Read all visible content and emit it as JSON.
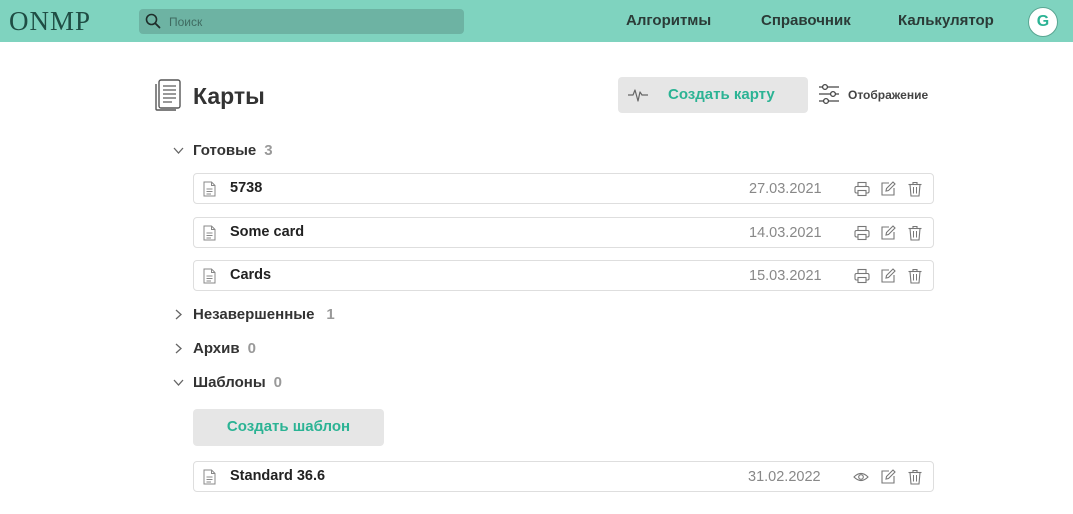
{
  "header": {
    "logo": "ONMP",
    "search": {
      "placeholder": "Поиск",
      "value": ""
    },
    "nav": [
      "Алгоритмы",
      "Справочник",
      "Калькулятор"
    ],
    "avatar_letter": "G"
  },
  "page": {
    "title": "Карты",
    "create_card_label": "Создать карту",
    "display_label": "Отображение"
  },
  "sections": {
    "ready": {
      "label": "Готовые",
      "count": "3",
      "expanded": true,
      "rows": [
        {
          "name": "5738",
          "date": "27.03.2021"
        },
        {
          "name": "Some card",
          "date": "14.03.2021"
        },
        {
          "name": "Cards",
          "date": "15.03.2021"
        }
      ]
    },
    "unfinished": {
      "label": "Незавершенные",
      "count": "1",
      "expanded": false
    },
    "archive": {
      "label": "Архив",
      "count": "0",
      "expanded": false
    },
    "templates": {
      "label": "Шаблоны",
      "count": "0",
      "expanded": true,
      "create_label": "Создать шаблон",
      "rows": [
        {
          "name": "Standard 36.6",
          "date": "31.02.2022"
        }
      ]
    }
  },
  "icons": {
    "row_actions_cards": [
      "print-icon",
      "edit-icon",
      "trash-icon"
    ],
    "row_actions_templates": [
      "eye-icon",
      "edit-icon",
      "trash-icon"
    ]
  },
  "colors": {
    "header_bg": "#7fd3bf",
    "search_bg": "#6db3a3",
    "accent": "#2bb394",
    "button_bg": "#e6e6e6"
  }
}
